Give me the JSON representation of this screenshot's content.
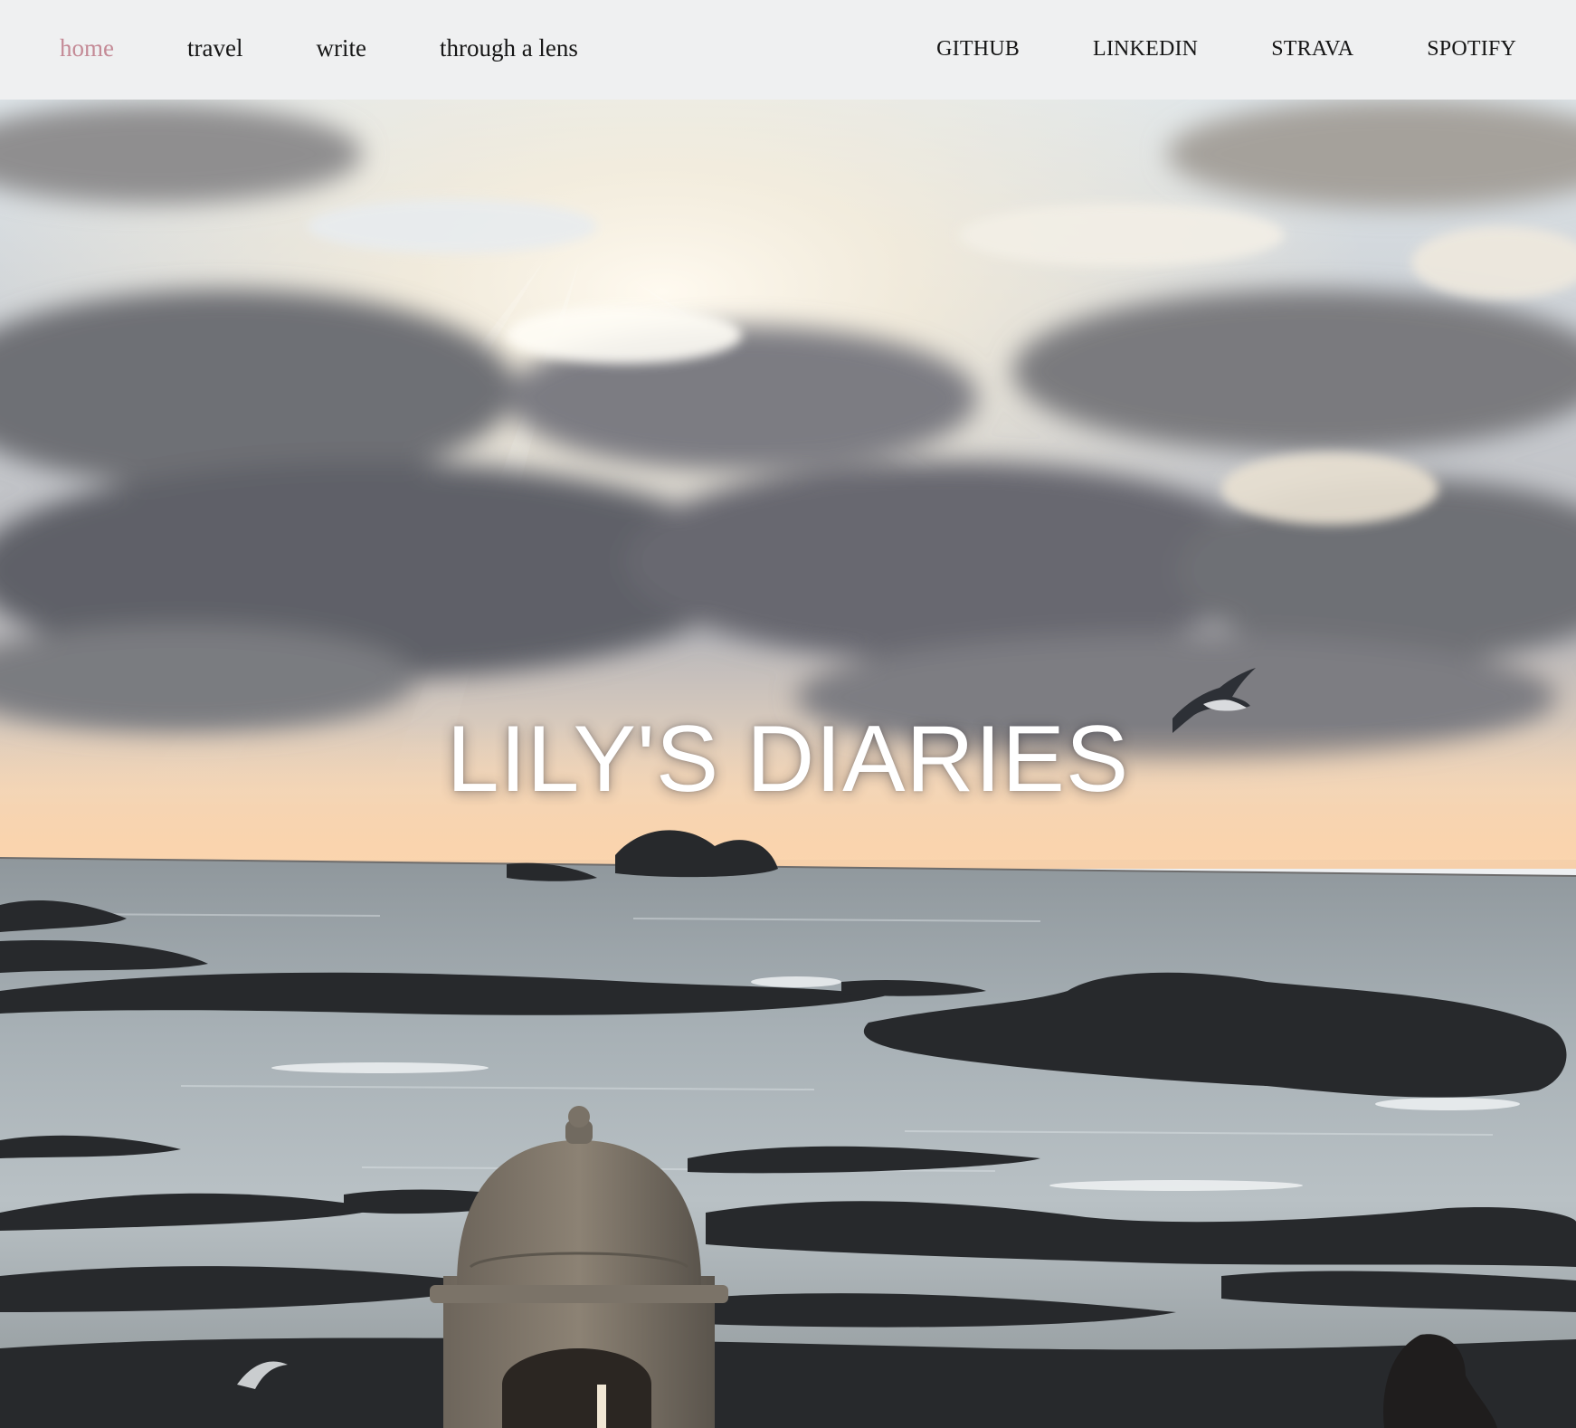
{
  "nav": {
    "links": [
      {
        "label": "home",
        "active": true
      },
      {
        "label": "travel",
        "active": false
      },
      {
        "label": "write",
        "active": false
      },
      {
        "label": "through a lens",
        "active": false
      }
    ],
    "social": [
      {
        "label": "GITHUB"
      },
      {
        "label": "LINKEDIN"
      },
      {
        "label": "STRAVA"
      },
      {
        "label": "SPOTIFY"
      }
    ]
  },
  "hero": {
    "title": "LILY'S DIARIES"
  },
  "colors": {
    "nav_background": "#eff0f1",
    "nav_active": "#c48a96",
    "nav_text": "#161616",
    "title_text": "#ffffff"
  }
}
